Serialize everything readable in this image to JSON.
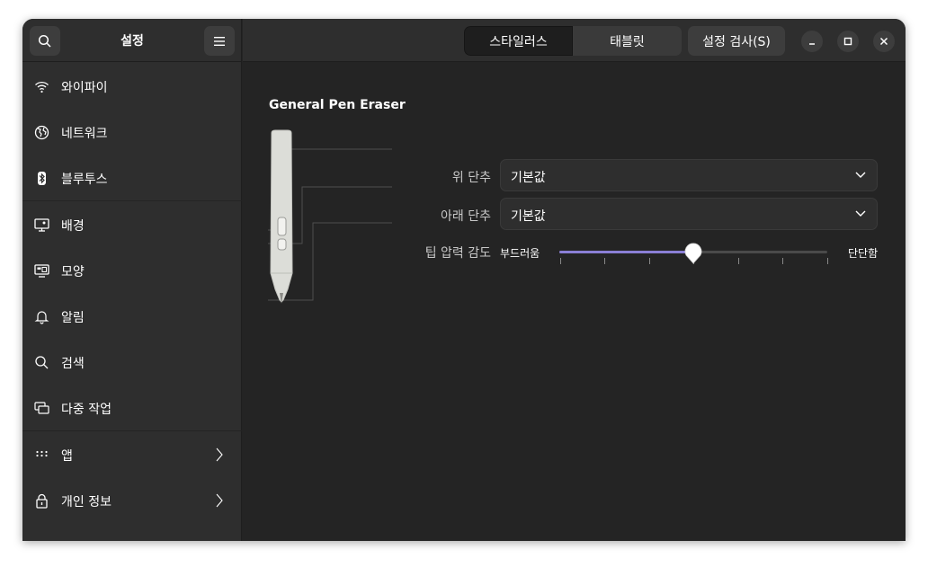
{
  "sidebar": {
    "title": "설정",
    "items": [
      {
        "label": "와이파이",
        "icon": "wifi-icon"
      },
      {
        "label": "네트워크",
        "icon": "globe-icon"
      },
      {
        "label": "블루투스",
        "icon": "bluetooth-icon"
      },
      {
        "label": "배경",
        "icon": "monitor-icon"
      },
      {
        "label": "모양",
        "icon": "palette-icon"
      },
      {
        "label": "알림",
        "icon": "bell-icon"
      },
      {
        "label": "검색",
        "icon": "search-icon"
      },
      {
        "label": "다중 작업",
        "icon": "multitask-icon"
      },
      {
        "label": "앱",
        "icon": "apps-grid-icon"
      },
      {
        "label": "개인 정보",
        "icon": "lock-icon"
      }
    ]
  },
  "header": {
    "tabs": [
      {
        "label": "스타일러스",
        "active": true
      },
      {
        "label": "태블릿",
        "active": false
      }
    ],
    "test_button": "설정 검사(S)"
  },
  "content": {
    "stylus_name": "General Pen Eraser",
    "top_button_label": "위 단추",
    "top_button_value": "기본값",
    "bottom_button_label": "아래 단추",
    "bottom_button_value": "기본값",
    "tip_pressure_label": "팁 압력 감도",
    "slider_min_label": "부드러움",
    "slider_max_label": "단단함",
    "tip_pressure_value": 0.5
  },
  "colors": {
    "accent": "#8b7fd6",
    "window_bg": "#242424",
    "sidebar_bg": "#2e2e2e"
  }
}
